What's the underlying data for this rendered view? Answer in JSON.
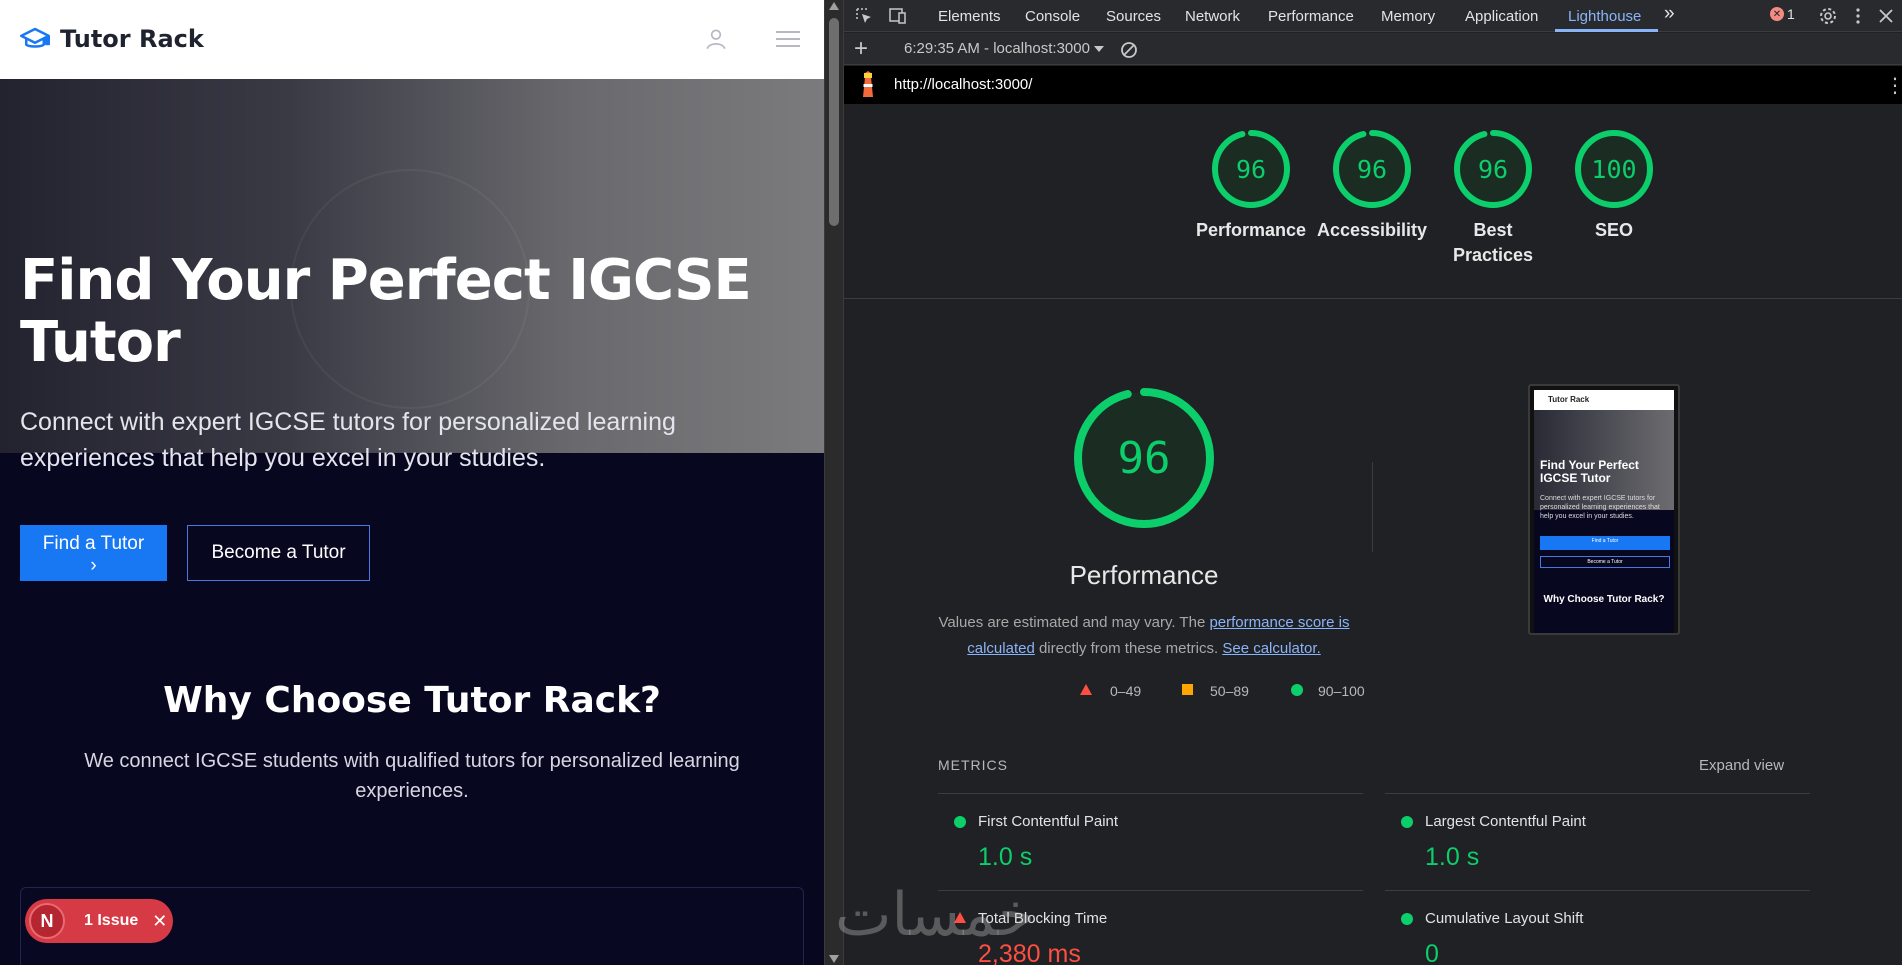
{
  "site": {
    "brand": "Tutor Rack",
    "hero_title": "Find Your Perfect IGCSE Tutor",
    "hero_sub": "Connect with expert IGCSE tutors for personalized learning experiences that help you excel in your studies.",
    "btn_find": "Find a Tutor",
    "btn_find_arrow": "›",
    "btn_become": "Become a Tutor",
    "why_title": "Why Choose Tutor Rack?",
    "why_sub": "We connect IGCSE students with qualified tutors for personalized learning experiences.",
    "issue_letter": "N",
    "issue_text": "1 Issue",
    "issue_close": "✕"
  },
  "devtools": {
    "tabs": [
      "Elements",
      "Console",
      "Sources",
      "Network",
      "Performance",
      "Memory",
      "Application",
      "Lighthouse"
    ],
    "active_tab": "Lighthouse",
    "more": "»",
    "error_count": "1",
    "error_glyph": "✕",
    "add": "+",
    "report_time": "6:29:35 AM - localhost:3000",
    "url": "http://localhost:3000/",
    "kebab": "⋮"
  },
  "scores": [
    {
      "label": "Performance",
      "value": 96
    },
    {
      "label": "Accessibility",
      "value": 96
    },
    {
      "label": "Best Practices",
      "value": 96
    },
    {
      "label": "SEO",
      "value": 100
    }
  ],
  "perf": {
    "score": 96,
    "label": "Performance",
    "estimate_prefix": "Values are estimated and may vary. The ",
    "estimate_link": "performance score is calculated",
    "estimate_mid": " directly from these metrics. ",
    "estimate_link2": "See calculator.",
    "legend": [
      "0–49",
      "50–89",
      "90–100"
    ]
  },
  "thumbnail": {
    "brand": "Tutor Rack",
    "title": "Find Your Perfect IGCSE Tutor",
    "sub": "Connect with expert IGCSE tutors for personalized learning experiences that help you excel in your studies.",
    "btn1": "Find a Tutor",
    "btn2": "Become a Tutor",
    "why": "Why Choose Tutor Rack?"
  },
  "metrics": {
    "heading": "METRICS",
    "expand": "Expand view",
    "items": [
      {
        "name": "First Contentful Paint",
        "value": "1.0 s",
        "status": "good"
      },
      {
        "name": "Largest Contentful Paint",
        "value": "1.0 s",
        "status": "good"
      },
      {
        "name": "Total Blocking Time",
        "value": "2,380 ms",
        "status": "poor"
      },
      {
        "name": "Cumulative Layout Shift",
        "value": "0",
        "status": "good"
      }
    ]
  },
  "colors": {
    "good": "#0cce6b",
    "average": "#ffa400",
    "poor": "#ff4e42",
    "accent": "#8ab4f8",
    "brand_blue": "#1878f3"
  },
  "watermark": "خمسات"
}
